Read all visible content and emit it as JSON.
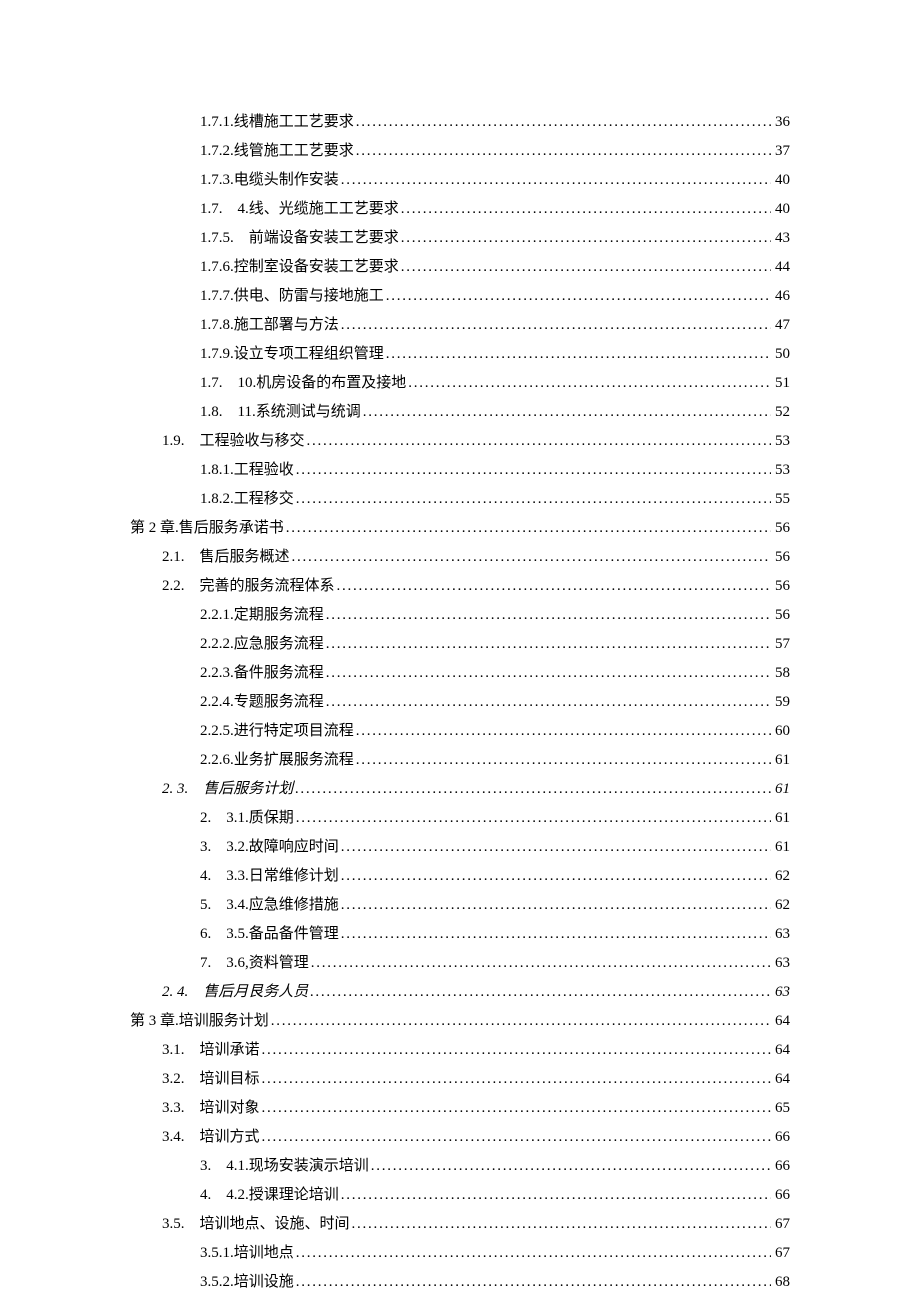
{
  "entries": [
    {
      "level": "indent2",
      "prefix": "1.7.1.",
      "label": "线槽施工工艺要求",
      "page": "36",
      "italic": false
    },
    {
      "level": "indent2",
      "prefix": "1.7.2.",
      "label": "线管施工工艺要求",
      "page": "37",
      "italic": false
    },
    {
      "level": "indent2",
      "prefix": "1.7.3.",
      "label": "电缆头制作安装",
      "page": "40",
      "italic": false
    },
    {
      "level": "indent2",
      "prefix": "1.7. 4.",
      "label": "线、光缆施工工艺要求",
      "page": "40",
      "italic": false
    },
    {
      "level": "indent2",
      "prefix": "1.7.5. ",
      "label": "前端设备安装工艺要求",
      "page": "43",
      "italic": false
    },
    {
      "level": "indent2",
      "prefix": "1.7.6.",
      "label": "控制室设备安装工艺要求",
      "page": "44",
      "italic": false
    },
    {
      "level": "indent2",
      "prefix": "1.7.7.",
      "label": "供电、防雷与接地施工",
      "page": "46",
      "italic": false
    },
    {
      "level": "indent2",
      "prefix": "1.7.8.",
      "label": "施工部署与方法",
      "page": "47",
      "italic": false
    },
    {
      "level": "indent2",
      "prefix": "1.7.9.",
      "label": "设立专项工程组织管理",
      "page": "50",
      "italic": false
    },
    {
      "level": "indent2",
      "prefix": "1.7. 10.",
      "label": "机房设备的布置及接地",
      "page": "51",
      "italic": false
    },
    {
      "level": "indent2",
      "prefix": "1.8. 11.",
      "label": "系统测试与统调",
      "page": "52",
      "italic": false
    },
    {
      "level": "indent1",
      "prefix": "1.9. ",
      "label": "工程验收与移交",
      "page": "53",
      "italic": false
    },
    {
      "level": "indent2",
      "prefix": "1.8.1.",
      "label": "工程验收",
      "page": "53",
      "italic": false
    },
    {
      "level": "indent2",
      "prefix": "1.8.2.",
      "label": "工程移交",
      "page": "55",
      "italic": false
    },
    {
      "level": "indent0",
      "prefix": "第 2 章. ",
      "label": "售后服务承诺书",
      "page": "56",
      "italic": false
    },
    {
      "level": "indent1",
      "prefix": "2.1. ",
      "label": "售后服务概述",
      "page": "56",
      "italic": false
    },
    {
      "level": "indent1",
      "prefix": "2.2. ",
      "label": "完善的服务流程体系",
      "page": "56",
      "italic": false
    },
    {
      "level": "indent2",
      "prefix": "2.2.1.",
      "label": "定期服务流程",
      "page": "56",
      "italic": false
    },
    {
      "level": "indent2",
      "prefix": "2.2.2.",
      "label": "应急服务流程",
      "page": "57",
      "italic": false
    },
    {
      "level": "indent2",
      "prefix": "2.2.3.",
      "label": "备件服务流程",
      "page": "58",
      "italic": false
    },
    {
      "level": "indent2",
      "prefix": "2.2.4.",
      "label": "专题服务流程",
      "page": "59",
      "italic": false
    },
    {
      "level": "indent2",
      "prefix": "2.2.5.",
      "label": "进行特定项目流程",
      "page": "60",
      "italic": false
    },
    {
      "level": "indent2",
      "prefix": "2.2.6.",
      "label": "业务扩展服务流程",
      "page": "61",
      "italic": false
    },
    {
      "level": "indent1",
      "prefix": "2. 3. ",
      "label": "售后服务计划",
      "page": "61",
      "italic": true
    },
    {
      "level": "indent2",
      "prefix": "2. 3.1.",
      "label": "质保期",
      "page": "61",
      "italic": false
    },
    {
      "level": "indent2",
      "prefix": "3. 3.2.",
      "label": "故障响应时间",
      "page": "61",
      "italic": false
    },
    {
      "level": "indent2",
      "prefix": "4. 3.3.",
      "label": "日常维修计划",
      "page": "62",
      "italic": false
    },
    {
      "level": "indent2",
      "prefix": "5. 3.4.",
      "label": "应急维修措施",
      "page": "62",
      "italic": false
    },
    {
      "level": "indent2",
      "prefix": "6. 3.5.",
      "label": "备品备件管理",
      "page": "63",
      "italic": false
    },
    {
      "level": "indent2",
      "prefix": "7. 3.6,",
      "label": "资料管理",
      "page": "63",
      "italic": false
    },
    {
      "level": "indent1",
      "prefix": "2. 4. ",
      "label": "售后月艮务人员",
      "page": "63",
      "italic": true
    },
    {
      "level": "indent0",
      "prefix": "第 3 章. ",
      "label": "培训服务计划",
      "page": "64",
      "italic": false
    },
    {
      "level": "indent1",
      "prefix": "3.1. ",
      "label": "培训承诺",
      "page": "64",
      "italic": false
    },
    {
      "level": "indent1",
      "prefix": "3.2. ",
      "label": "培训目标",
      "page": "64",
      "italic": false
    },
    {
      "level": "indent1",
      "prefix": "3.3. ",
      "label": "培训对象",
      "page": "65",
      "italic": false
    },
    {
      "level": "indent1",
      "prefix": "3.4. ",
      "label": "培训方式",
      "page": "66",
      "italic": false
    },
    {
      "level": "indent2",
      "prefix": "3. 4.1.",
      "label": "现场安装演示培训",
      "page": "66",
      "italic": false
    },
    {
      "level": "indent2",
      "prefix": "4. 4.2.",
      "label": "授课理论培训",
      "page": "66",
      "italic": false
    },
    {
      "level": "indent1",
      "prefix": "3.5. ",
      "label": "培训地点、设施、时间",
      "page": "67",
      "italic": false
    },
    {
      "level": "indent2",
      "prefix": "3.5.1.",
      "label": "培训地点",
      "page": "67",
      "italic": false
    },
    {
      "level": "indent2",
      "prefix": "3.5.2.",
      "label": "培训设施",
      "page": "68",
      "italic": false
    }
  ]
}
